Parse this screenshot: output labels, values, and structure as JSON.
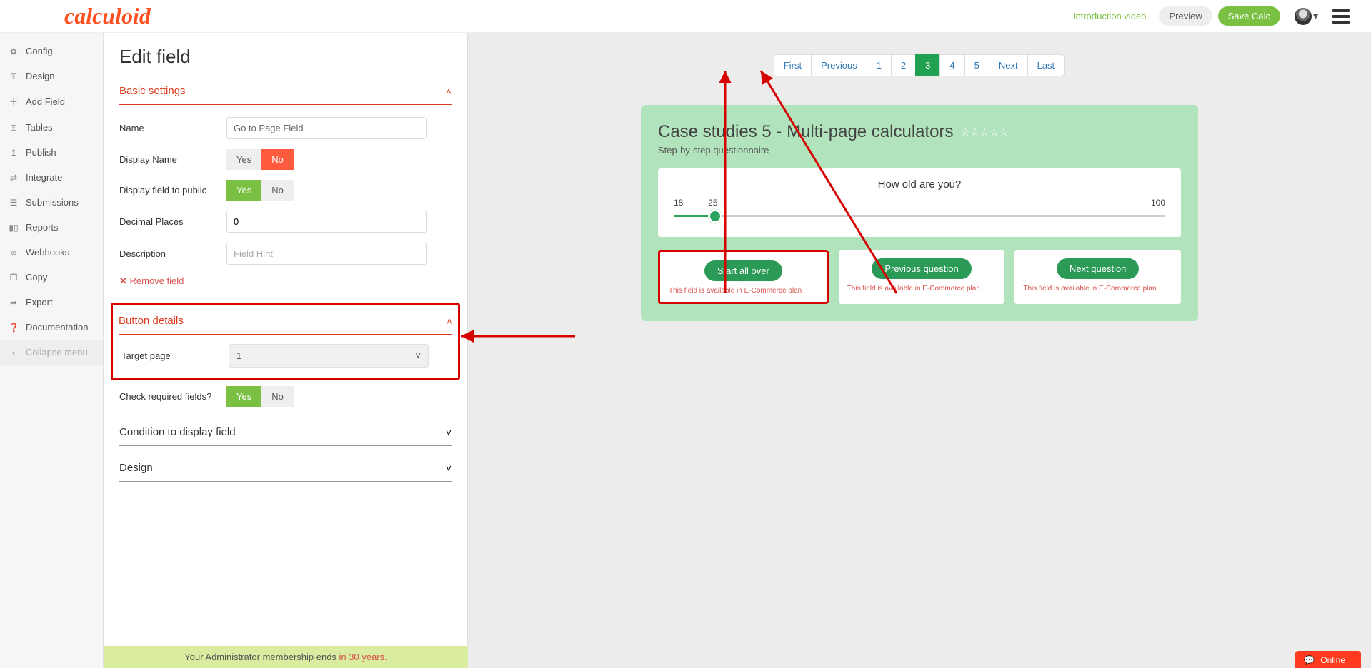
{
  "header": {
    "intro_video": "Introduction video",
    "preview": "Preview",
    "save": "Save Calc"
  },
  "sidebar": {
    "items": [
      {
        "label": "Config"
      },
      {
        "label": "Design"
      },
      {
        "label": "Add Field"
      },
      {
        "label": "Tables"
      },
      {
        "label": "Publish"
      },
      {
        "label": "Integrate"
      },
      {
        "label": "Submissions"
      },
      {
        "label": "Reports"
      },
      {
        "label": "Webhooks"
      },
      {
        "label": "Copy"
      },
      {
        "label": "Export"
      },
      {
        "label": "Documentation"
      },
      {
        "label": "Collapse menu"
      }
    ]
  },
  "edit": {
    "title": "Edit field",
    "basic_settings": "Basic settings",
    "name_label": "Name",
    "name_value": "Go to Page Field",
    "display_name_label": "Display Name",
    "display_public_label": "Display field to public",
    "decimal_label": "Decimal Places",
    "decimal_value": "0",
    "desc_label": "Description",
    "desc_placeholder": "Field Hint",
    "remove": "Remove field",
    "button_details": "Button details",
    "target_page_label": "Target page",
    "target_page_value": "1",
    "check_required_label": "Check required fields?",
    "condition": "Condition to display field",
    "design": "Design",
    "yes": "Yes",
    "no": "No"
  },
  "pagination": {
    "first": "First",
    "prev": "Previous",
    "p1": "1",
    "p2": "2",
    "p3": "3",
    "p4": "4",
    "p5": "5",
    "next": "Next",
    "last": "Last"
  },
  "calc": {
    "title": "Case studies 5 - Multi-page calculators",
    "subtitle": "Step-by-step questionnaire",
    "question": "How old are you?",
    "min": "18",
    "mid": "25",
    "max": "100",
    "start_over": "Start all over",
    "prev_q": "Previous question",
    "next_q": "Next question",
    "plan_note": "This field is available in E-Commerce plan"
  },
  "membership": {
    "text": "Your Administrator membership ends ",
    "highlight": "in 30 years."
  },
  "online": "Online"
}
